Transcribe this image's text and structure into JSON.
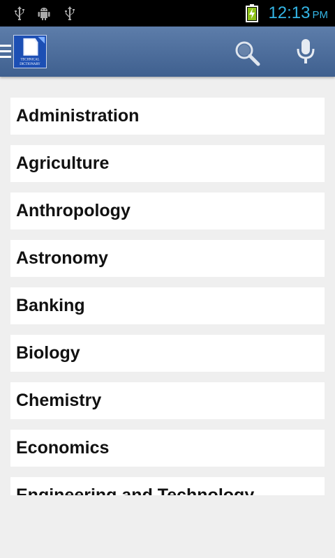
{
  "status_bar": {
    "time": "12:13",
    "ampm": "PM",
    "icons": [
      "usb-icon",
      "android-debug-icon",
      "usb-icon",
      "battery-charging-icon"
    ]
  },
  "action_bar": {
    "logo_lines": [
      "TECHNICAL",
      "DICTIONARY"
    ],
    "icons": [
      "drawer-icon",
      "app-logo",
      "search-icon",
      "microphone-icon"
    ]
  },
  "list": {
    "items": [
      {
        "label": "Administration"
      },
      {
        "label": "Agriculture"
      },
      {
        "label": "Anthropology"
      },
      {
        "label": "Astronomy"
      },
      {
        "label": "Banking"
      },
      {
        "label": "Biology"
      },
      {
        "label": "Chemistry"
      },
      {
        "label": "Economics"
      },
      {
        "label": "Engineering and Technology"
      }
    ]
  },
  "colors": {
    "action_bar": "#4a6b99",
    "status_time": "#33b5e5",
    "background": "#efefef"
  }
}
